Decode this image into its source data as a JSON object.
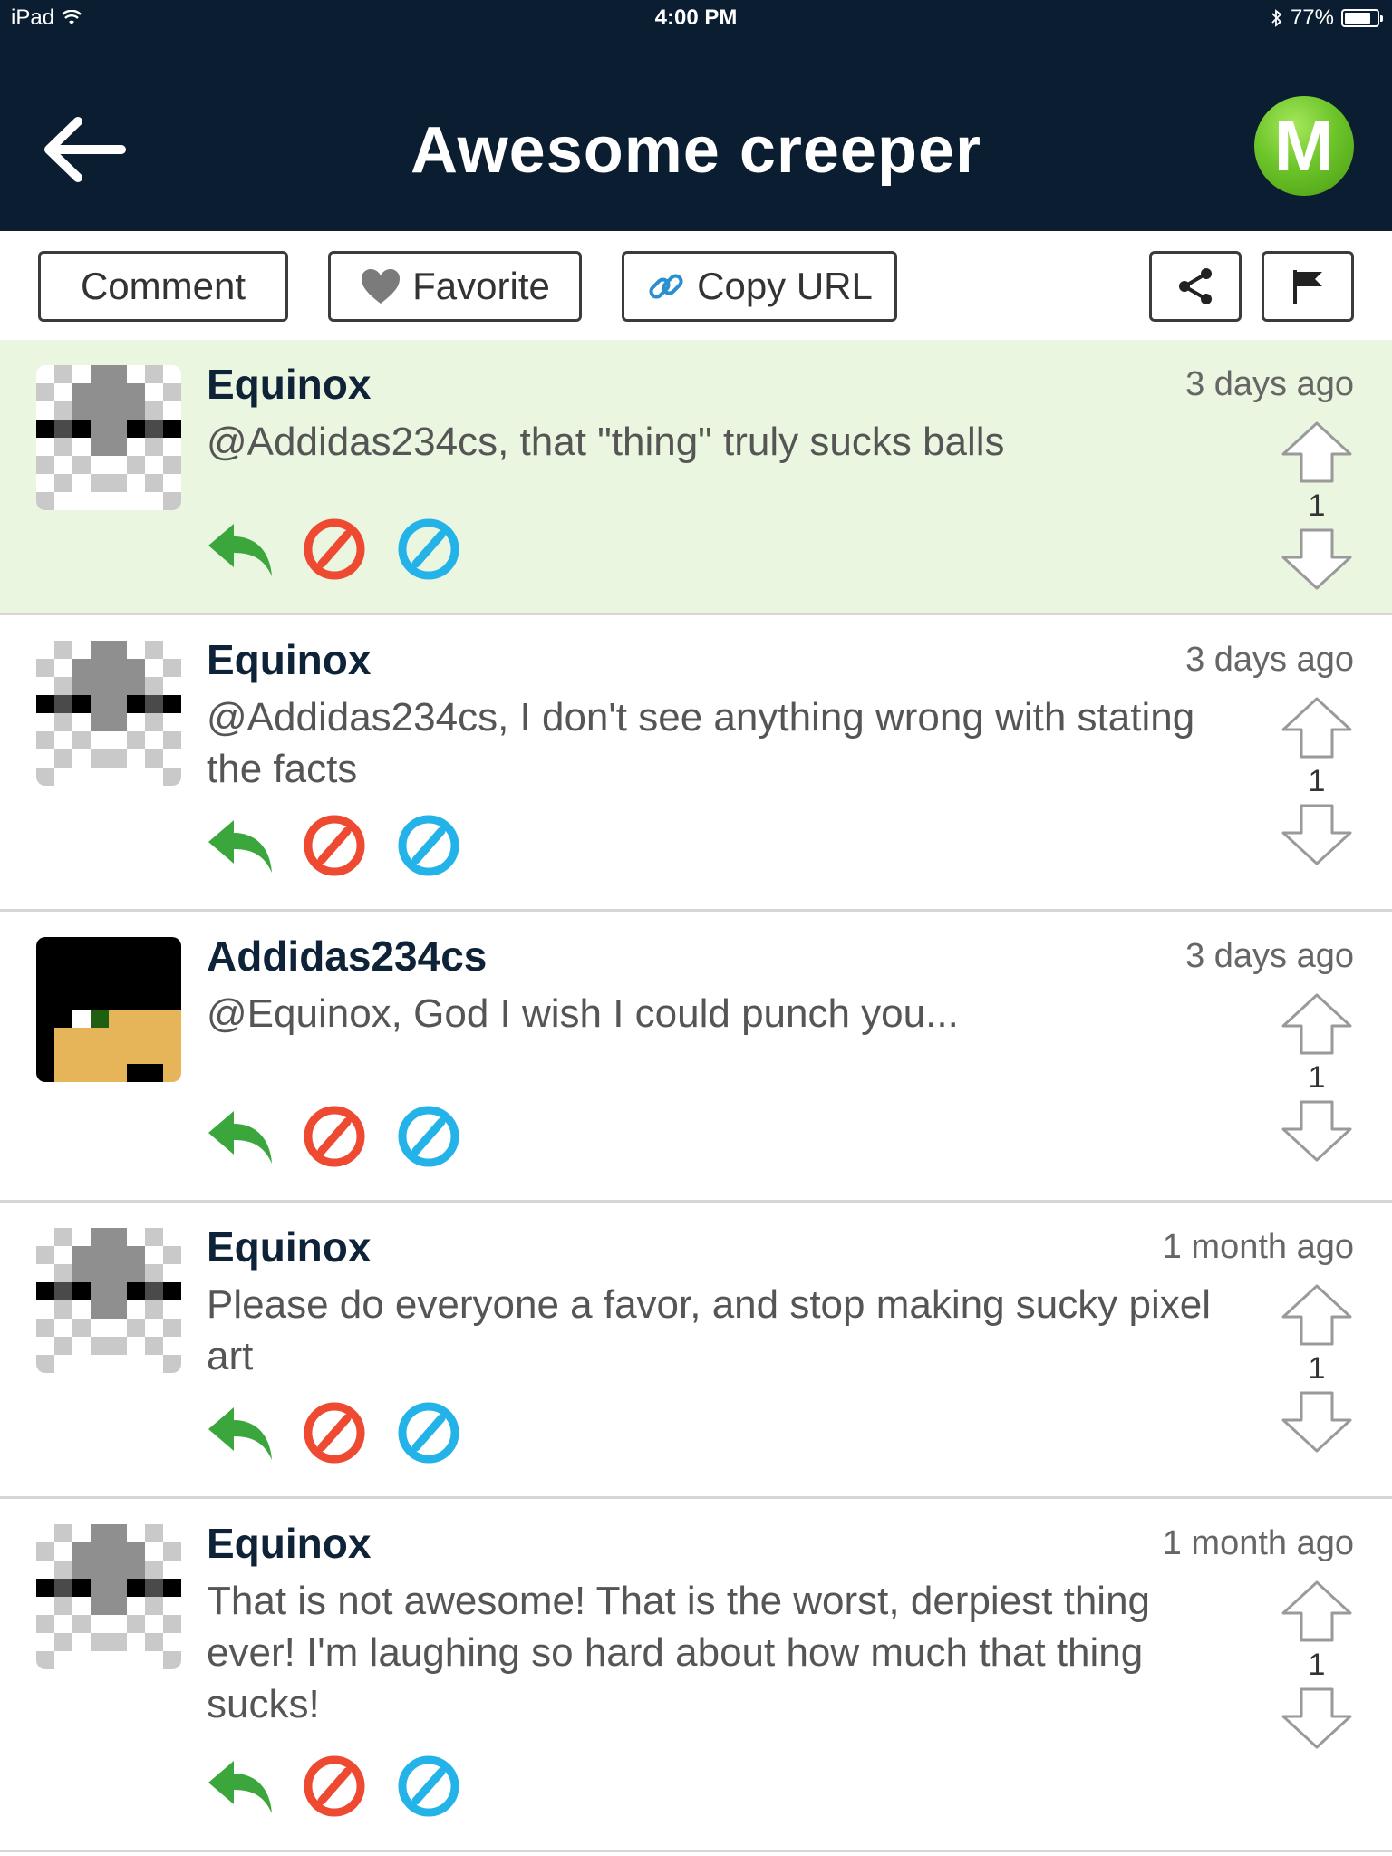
{
  "status_bar": {
    "device": "iPad",
    "time": "4:00 PM",
    "battery": "77%",
    "battery_level": 0.77
  },
  "header": {
    "title": "Awesome creeper",
    "logo_letter": "M"
  },
  "toolbar": {
    "comment_label": "Comment",
    "favorite_label": "Favorite",
    "copy_url_label": "Copy URL"
  },
  "colors": {
    "header_bg": "#0b1d31",
    "highlight_bg": "#eaf6df",
    "reply_green": "#3aa63c",
    "block_red": "#ee4a32",
    "ignore_blue": "#23b3e8"
  },
  "comments": [
    {
      "author": "Equinox",
      "time": "3 days ago",
      "text": "@Addidas234cs, that \"thing\" truly sucks balls",
      "votes": "1",
      "avatar": "skeleton",
      "highlight": true
    },
    {
      "author": "Equinox",
      "time": "3 days ago",
      "text": "@Addidas234cs, I don't see anything wrong with stating the facts",
      "votes": "1",
      "avatar": "skeleton"
    },
    {
      "author": "Addidas234cs",
      "time": "3 days ago",
      "text": "@Equinox, God I wish I could punch you...",
      "votes": "1",
      "avatar": "steve"
    },
    {
      "author": "Equinox",
      "time": "1 month ago",
      "text": "Please do everyone a favor, and stop making sucky pixel art",
      "votes": "1",
      "avatar": "skeleton"
    },
    {
      "author": "Equinox",
      "time": "1 month ago",
      "text": "That is not awesome! That is the worst, derpiest thing ever! I'm laughing so hard about how much that thing sucks!",
      "votes": "1",
      "avatar": "skeleton"
    }
  ]
}
